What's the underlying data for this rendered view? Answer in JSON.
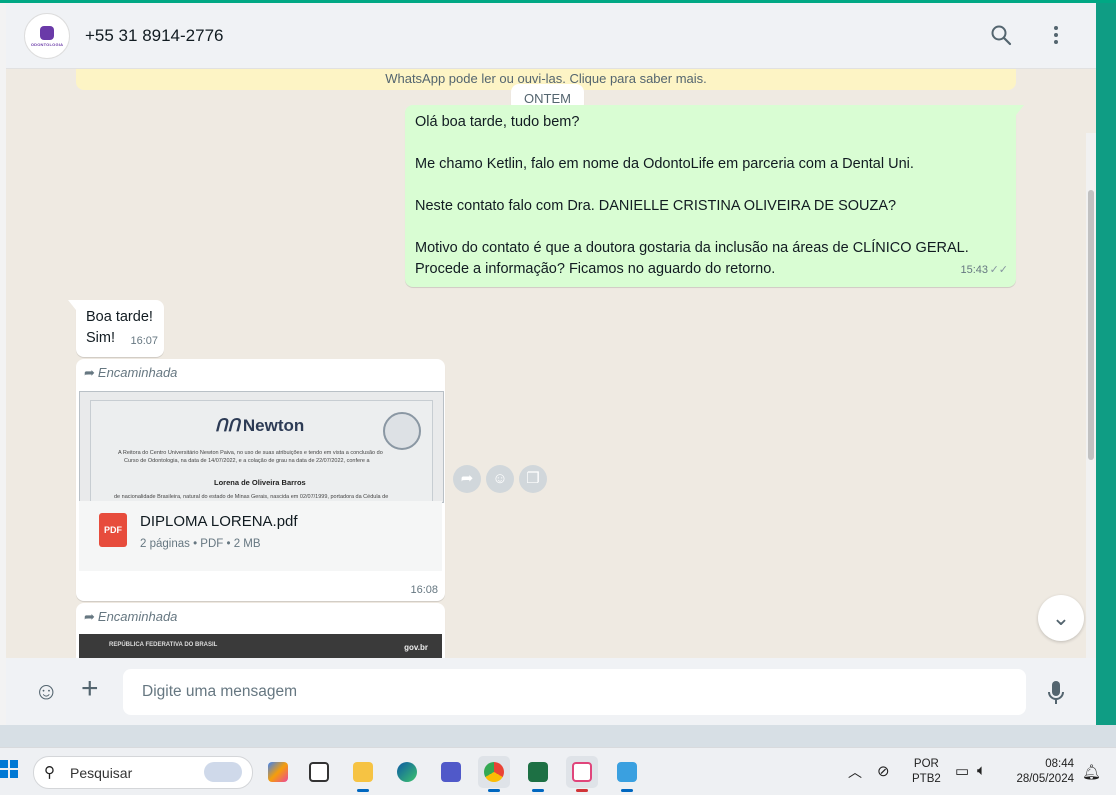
{
  "header": {
    "logo_text": "ODONTOLOGIA",
    "contact_name": "+55 31 8914-2776",
    "search_icon": "search-icon",
    "menu_icon": "kebab-menu-icon"
  },
  "chat": {
    "notice_text": "WhatsApp pode ler ou ouvi-las. Clique para saber mais.",
    "date_divider": "ONTEM",
    "outgoing_message": {
      "lines": [
        "Olá boa tarde, tudo bem?",
        "Me chamo Ketlin, falo em nome da OdontoLife em parceria com a Dental Uni.",
        "Neste contato falo com Dra. DANIELLE CRISTINA OLIVEIRA DE SOUZA?",
        "Motivo do contato é que a doutora gostaria da inclusão na áreas de CLÍNICO GERAL.",
        "Procede a informação? Ficamos no aguardo do retorno."
      ],
      "time": "15:43",
      "status": "read"
    },
    "incoming_message": {
      "line1": "Boa tarde!",
      "line2": "Sim!",
      "time": "16:07"
    },
    "document_message": {
      "forwarded_label": "Encaminhada",
      "preview": {
        "brand": "Newton",
        "text1": "A Reitora do Centro Universitário Newton Paiva, no uso de suas atribuições e tendo em vista a conclusão do",
        "text2": "Curso de Odontologia, na data de 14/07/2022, e a colação de grau na data de 22/07/2022, confere a",
        "name": "Lorena de Oliveira Barros",
        "text3": "de nacionalidade Brasileira, natural do estado de Minas Gerais, nascida em 02/07/1999, portadora da Cédula de"
      },
      "file_name": "DIPLOMA LORENA.pdf",
      "file_type_badge": "PDF",
      "file_meta": "2 páginas • PDF • 2 MB",
      "time": "16:08"
    },
    "document_message_2": {
      "forwarded_label": "Encaminhada",
      "preview_left": "REPÚBLICA FEDERATIVA DO BRASIL",
      "preview_right": "gov.br"
    }
  },
  "composer": {
    "placeholder": "Digite uma mensagem"
  },
  "taskbar": {
    "search_label": "Pesquisar",
    "lang_line1": "POR",
    "lang_line2": "PTB2",
    "time": "08:44",
    "date": "28/05/2024"
  },
  "colors": {
    "outgoing_bubble": "#d9fdd3",
    "chat_background": "#efeae2",
    "accent": "#00a884"
  }
}
